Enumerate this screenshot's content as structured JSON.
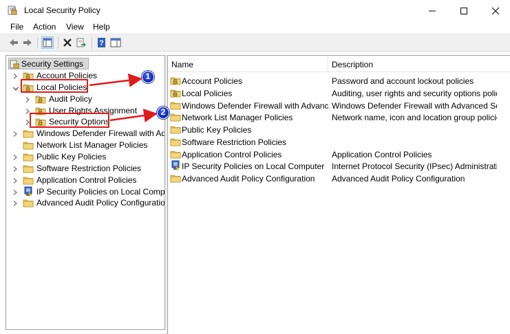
{
  "window": {
    "title": "Local Security Policy",
    "app_icon": "security-policy-icon"
  },
  "menu": [
    "File",
    "Action",
    "View",
    "Help"
  ],
  "toolbar": {
    "icons": [
      "back-arrow-icon",
      "forward-arrow-icon",
      "show-hide-tree-icon",
      "delete-icon",
      "export-list-icon",
      "help-icon",
      "properties-pane-icon"
    ]
  },
  "tree": {
    "root": "Security Settings",
    "items": [
      {
        "label": "Account Policies",
        "level": 1,
        "expander": "collapsed"
      },
      {
        "label": "Local Policies",
        "level": 1,
        "expander": "expanded"
      },
      {
        "label": "Audit Policy",
        "level": 2,
        "expander": "collapsed"
      },
      {
        "label": "User Rights Assignment",
        "level": 2,
        "expander": "collapsed"
      },
      {
        "label": "Security Options",
        "level": 2,
        "expander": "collapsed"
      },
      {
        "label": "Windows Defender Firewall with Adva",
        "level": 1,
        "expander": "collapsed"
      },
      {
        "label": "Network List Manager Policies",
        "level": 1,
        "expander": "none"
      },
      {
        "label": "Public Key Policies",
        "level": 1,
        "expander": "collapsed"
      },
      {
        "label": "Software Restriction Policies",
        "level": 1,
        "expander": "collapsed"
      },
      {
        "label": "Application Control Policies",
        "level": 1,
        "expander": "collapsed"
      },
      {
        "label": "IP Security Policies on Local Compute",
        "level": 1,
        "expander": "collapsed",
        "icon": "ip-security-icon"
      },
      {
        "label": "Advanced Audit Policy Configuration",
        "level": 1,
        "expander": "collapsed"
      }
    ]
  },
  "list": {
    "columns": [
      "Name",
      "Description"
    ],
    "rows": [
      {
        "name": "Account Policies",
        "description": "Password and account lockout policies"
      },
      {
        "name": "Local Policies",
        "description": "Auditing, user rights and security options polici..."
      },
      {
        "name": "Windows Defender Firewall with Advanc...",
        "description": "Windows Defender Firewall with Advanced Sec..."
      },
      {
        "name": "Network List Manager Policies",
        "description": "Network name, icon and location group policies."
      },
      {
        "name": "Public Key Policies",
        "description": ""
      },
      {
        "name": "Software Restriction Policies",
        "description": ""
      },
      {
        "name": "Application Control Policies",
        "description": "Application Control Policies"
      },
      {
        "name": "IP Security Policies on Local Computer",
        "description": "Internet Protocol Security (IPsec) Administratio..."
      },
      {
        "name": "Advanced Audit Policy Configuration",
        "description": "Advanced Audit Policy Configuration"
      }
    ]
  },
  "annotations": [
    {
      "number": "1",
      "target": "Local Policies"
    },
    {
      "number": "2",
      "target": "Security Options"
    }
  ],
  "colors": {
    "annotation_red": "#e01b1b",
    "badge_blue": "#1430c8",
    "folder_yellow": "#e8c35a",
    "selection_grey": "#d9d9d9"
  }
}
